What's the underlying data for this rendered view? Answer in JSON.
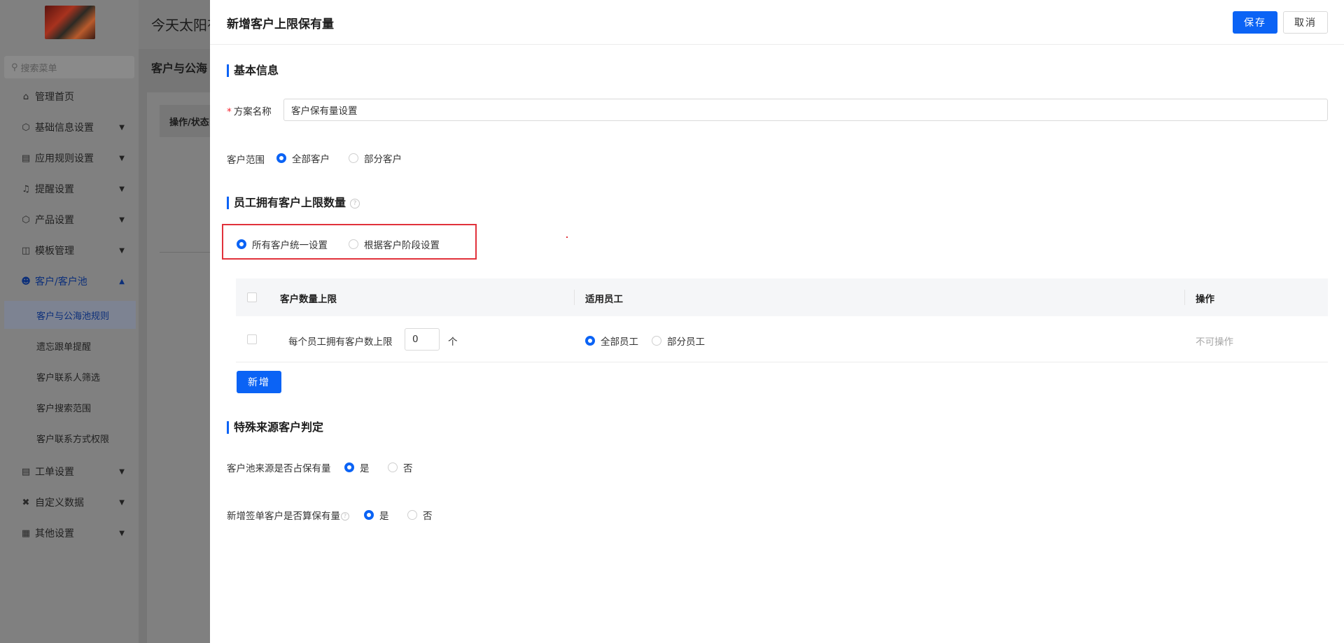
{
  "background": {
    "topbar_text": "今天太阳有",
    "breadcrumb": "客户与公海",
    "table_header_partial": "操作/状态",
    "search_placeholder": "搜索菜单",
    "menu": [
      {
        "label": "管理首页",
        "icon": "home-icon",
        "has_chevron": false
      },
      {
        "label": "基础信息设置",
        "icon": "cube-icon",
        "has_chevron": true
      },
      {
        "label": "应用规则设置",
        "icon": "document-icon",
        "has_chevron": true
      },
      {
        "label": "提醒设置",
        "icon": "bell-icon",
        "has_chevron": true
      },
      {
        "label": "产品设置",
        "icon": "cube-icon",
        "has_chevron": true
      },
      {
        "label": "模板管理",
        "icon": "template-icon",
        "has_chevron": true
      },
      {
        "label": "客户/客户池",
        "icon": "users-icon",
        "has_chevron": true,
        "expanded": true
      },
      {
        "label": "工单设置",
        "icon": "ticket-icon",
        "has_chevron": true
      },
      {
        "label": "自定义数据",
        "icon": "tools-icon",
        "has_chevron": true
      },
      {
        "label": "其他设置",
        "icon": "grid-icon",
        "has_chevron": true
      }
    ],
    "submenu": [
      {
        "label": "客户与公海池规则",
        "active": true
      },
      {
        "label": "遗忘跟单提醒"
      },
      {
        "label": "客户联系人筛选"
      },
      {
        "label": "客户搜索范围"
      },
      {
        "label": "客户联系方式权限"
      }
    ]
  },
  "drawer": {
    "title": "新增客户上限保有量",
    "save_label": "保存",
    "cancel_label": "取消",
    "basic": {
      "section_title": "基本信息",
      "required_mark": "*",
      "name_label": "方案名称",
      "name_value": "客户保有量设置",
      "scope_label": "客户范围",
      "scope_options": [
        "全部客户",
        "部分客户"
      ],
      "scope_selected": "全部客户"
    },
    "limit": {
      "section_title": "员工拥有客户上限数量",
      "mode_options": [
        "所有客户统一设置",
        "根据客户阶段设置"
      ],
      "mode_selected": "所有客户统一设置",
      "table": {
        "headers": [
          "客户数量上限",
          "适用员工",
          "操作"
        ],
        "row": {
          "limit_label": "每个员工拥有客户数上限",
          "limit_value": "0",
          "unit": "个",
          "staff_options": [
            "全部员工",
            "部分员工"
          ],
          "staff_selected": "全部员工",
          "action_text": "不可操作"
        }
      },
      "add_label": "新增"
    },
    "special": {
      "section_title": "特殊来源客户判定",
      "pool_label": "客户池来源是否占保有量",
      "pool_options": [
        "是",
        "否"
      ],
      "pool_selected": "是",
      "signed_label": "新增签单客户是否算保有量",
      "signed_options": [
        "是",
        "否"
      ],
      "signed_selected": "是"
    }
  },
  "colors": {
    "primary": "#0b63f5",
    "highlight_border": "#e1323b",
    "overlay_gray": "#7b7b7b"
  }
}
